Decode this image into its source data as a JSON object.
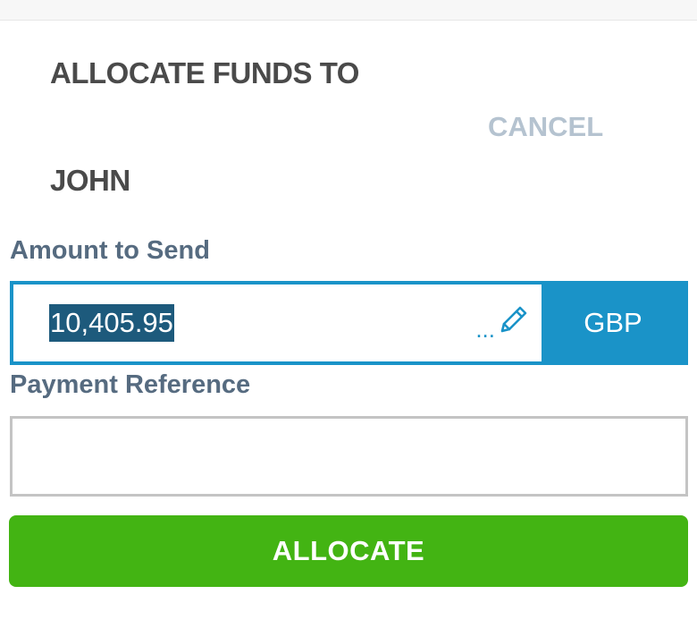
{
  "dialog": {
    "title_line1": "ALLOCATE FUNDS TO",
    "title_line2": "JOHN",
    "cancel_label": "CANCEL"
  },
  "amount": {
    "label": "Amount to Send",
    "value": "10,405.95",
    "edit_dots": "...",
    "edit_icon": "pencil-icon",
    "currency": "GBP"
  },
  "reference": {
    "label": "Payment Reference",
    "value": ""
  },
  "actions": {
    "allocate_label": "ALLOCATE"
  },
  "colors": {
    "accent": "#1a93c8",
    "selection": "#1d5a7c",
    "primary_button": "#43b413",
    "cancel_text": "#b5c3d0",
    "label_text": "#566b80",
    "title_text": "#4a4a4a"
  }
}
